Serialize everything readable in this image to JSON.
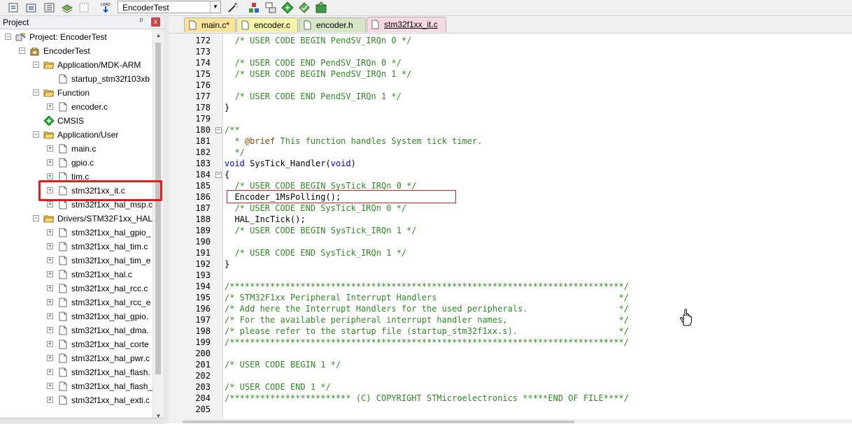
{
  "toolbar": {
    "target_name": "EncoderTest",
    "buttons": [
      "options-icon",
      "rebuild-icon",
      "batch-build-icon",
      "layers-icon",
      "download-icon",
      "load-icon",
      "magic-wand-icon",
      "manage-components-icon",
      "multiproject-icon",
      "diamond-icon",
      "select-packs-icon",
      "pack-installer-icon"
    ],
    "load_label": "LOAD"
  },
  "project_panel": {
    "title": "Project",
    "pin": "ᵖ",
    "close": "x",
    "tree": [
      {
        "label": "Project: EncoderTest",
        "level": 0,
        "icon": "project-icon",
        "expander": "−"
      },
      {
        "label": "EncoderTest",
        "level": 1,
        "icon": "target-icon",
        "expander": "−"
      },
      {
        "label": "Application/MDK-ARM",
        "level": 2,
        "icon": "folder-open-icon",
        "expander": "−"
      },
      {
        "label": "startup_stm32f103xb",
        "level": 3,
        "icon": "file-icon",
        "expander": ""
      },
      {
        "label": "Function",
        "level": 2,
        "icon": "folder-open-icon",
        "expander": "−"
      },
      {
        "label": "encoder.c",
        "level": 3,
        "icon": "file-icon",
        "expander": "+"
      },
      {
        "label": "CMSIS",
        "level": 2,
        "icon": "cmsis-icon",
        "expander": ""
      },
      {
        "label": "Application/User",
        "level": 2,
        "icon": "folder-open-icon",
        "expander": "−"
      },
      {
        "label": "main.c",
        "level": 3,
        "icon": "file-icon",
        "expander": "+"
      },
      {
        "label": "gpio.c",
        "level": 3,
        "icon": "file-icon",
        "expander": "+"
      },
      {
        "label": "tim.c",
        "level": 3,
        "icon": "file-icon",
        "expander": "+"
      },
      {
        "label": "stm32f1xx_it.c",
        "level": 3,
        "icon": "file-icon",
        "expander": "+"
      },
      {
        "label": "stm32f1xx_hal_msp.c",
        "level": 3,
        "icon": "file-icon",
        "expander": "+"
      },
      {
        "label": "Drivers/STM32F1xx_HAL",
        "level": 2,
        "icon": "folder-open-icon",
        "expander": "−"
      },
      {
        "label": "stm32f1xx_hal_gpio_",
        "level": 3,
        "icon": "file-icon",
        "expander": "+"
      },
      {
        "label": "stm32f1xx_hal_tim.c",
        "level": 3,
        "icon": "file-icon",
        "expander": "+"
      },
      {
        "label": "stm32f1xx_hal_tim_e",
        "level": 3,
        "icon": "file-icon",
        "expander": "+"
      },
      {
        "label": "stm32f1xx_hal.c",
        "level": 3,
        "icon": "file-icon",
        "expander": "+"
      },
      {
        "label": "stm32f1xx_hal_rcc.c",
        "level": 3,
        "icon": "file-icon",
        "expander": "+"
      },
      {
        "label": "stm32f1xx_hal_rcc_e",
        "level": 3,
        "icon": "file-icon",
        "expander": "+"
      },
      {
        "label": "stm32f1xx_hal_gpio.",
        "level": 3,
        "icon": "file-icon",
        "expander": "+"
      },
      {
        "label": "stm32f1xx_hal_dma.",
        "level": 3,
        "icon": "file-icon",
        "expander": "+"
      },
      {
        "label": "stm32f1xx_hal_corte",
        "level": 3,
        "icon": "file-icon",
        "expander": "+"
      },
      {
        "label": "stm32f1xx_hal_pwr.c",
        "level": 3,
        "icon": "file-icon",
        "expander": "+"
      },
      {
        "label": "stm32f1xx_hal_flash.",
        "level": 3,
        "icon": "file-icon",
        "expander": "+"
      },
      {
        "label": "stm32f1xx_hal_flash_",
        "level": 3,
        "icon": "file-icon",
        "expander": "+"
      },
      {
        "label": "stm32f1xx_hal_exti.c",
        "level": 3,
        "icon": "file-icon",
        "expander": "+"
      }
    ]
  },
  "tabs": [
    {
      "label": "main.c*",
      "color": "#fbe39a",
      "active": false
    },
    {
      "label": "encoder.c",
      "color": "#f4f3a8",
      "active": false
    },
    {
      "label": "encoder.h",
      "color": "#d6e6c4",
      "active": false
    },
    {
      "label": "stm32f1xx_it.c",
      "color": "#f7d9e0",
      "active": true
    }
  ],
  "code_lines": [
    {
      "n": "172",
      "fold": "",
      "segs": [
        {
          "t": "  /* USER CODE BEGIN PendSV_IRQn 0 */",
          "c": "c-com"
        }
      ]
    },
    {
      "n": "173",
      "fold": "",
      "segs": []
    },
    {
      "n": "174",
      "fold": "",
      "segs": [
        {
          "t": "  /* USER CODE END PendSV_IRQn 0 */",
          "c": "c-com"
        }
      ]
    },
    {
      "n": "175",
      "fold": "",
      "segs": [
        {
          "t": "  /* USER CODE BEGIN PendSV_IRQn 1 */",
          "c": "c-com"
        }
      ]
    },
    {
      "n": "176",
      "fold": "",
      "segs": []
    },
    {
      "n": "177",
      "fold": "",
      "segs": [
        {
          "t": "  /* USER CODE END PendSV_IRQn 1 */",
          "c": "c-com"
        }
      ]
    },
    {
      "n": "178",
      "fold": "",
      "segs": [
        {
          "t": "}",
          "c": ""
        }
      ]
    },
    {
      "n": "179",
      "fold": "",
      "segs": []
    },
    {
      "n": "180",
      "fold": "−",
      "segs": [
        {
          "t": "/**",
          "c": "c-com"
        }
      ]
    },
    {
      "n": "181",
      "fold": "",
      "segs": [
        {
          "t": "  * ",
          "c": "c-com"
        },
        {
          "t": "@brief",
          "c": "c-tag"
        },
        {
          "t": " This function handles System tick timer.",
          "c": "c-com"
        }
      ]
    },
    {
      "n": "182",
      "fold": "",
      "segs": [
        {
          "t": "  */",
          "c": "c-com"
        }
      ]
    },
    {
      "n": "183",
      "fold": "",
      "segs": [
        {
          "t": "void",
          "c": "c-kw"
        },
        {
          "t": " SysTick_Handler(",
          "c": ""
        },
        {
          "t": "void",
          "c": "c-kw"
        },
        {
          "t": ")",
          "c": ""
        }
      ]
    },
    {
      "n": "184",
      "fold": "−",
      "segs": [
        {
          "t": "{",
          "c": ""
        }
      ]
    },
    {
      "n": "185",
      "fold": "",
      "segs": [
        {
          "t": "  /* USER CODE BEGIN SysTick_IRQn 0 */",
          "c": "c-com"
        }
      ]
    },
    {
      "n": "186",
      "fold": "",
      "segs": [
        {
          "t": "  Encoder_1MsPolling();",
          "c": ""
        }
      ]
    },
    {
      "n": "187",
      "fold": "",
      "segs": [
        {
          "t": "  /* USER CODE END SysTick_IRQn 0 */",
          "c": "c-com"
        }
      ]
    },
    {
      "n": "188",
      "fold": "",
      "segs": [
        {
          "t": "  HAL_IncTick();",
          "c": ""
        }
      ]
    },
    {
      "n": "189",
      "fold": "",
      "segs": [
        {
          "t": "  /* USER CODE BEGIN SysTick_IRQn 1 */",
          "c": "c-com"
        }
      ]
    },
    {
      "n": "190",
      "fold": "",
      "segs": []
    },
    {
      "n": "191",
      "fold": "",
      "segs": [
        {
          "t": "  /* USER CODE END SysTick_IRQn 1 */",
          "c": "c-com"
        }
      ]
    },
    {
      "n": "192",
      "fold": "",
      "segs": [
        {
          "t": "}",
          "c": ""
        }
      ]
    },
    {
      "n": "193",
      "fold": "",
      "segs": []
    },
    {
      "n": "194",
      "fold": "",
      "segs": [
        {
          "t": "/******************************************************************************/",
          "c": "c-com"
        }
      ]
    },
    {
      "n": "195",
      "fold": "",
      "segs": [
        {
          "t": "/* STM32F1xx Peripheral Interrupt Handlers                                    */",
          "c": "c-com"
        }
      ]
    },
    {
      "n": "196",
      "fold": "",
      "segs": [
        {
          "t": "/* Add here the Interrupt Handlers for the used peripherals.                  */",
          "c": "c-com"
        }
      ]
    },
    {
      "n": "197",
      "fold": "",
      "segs": [
        {
          "t": "/* For the available peripheral interrupt handler names,                      */",
          "c": "c-com"
        }
      ]
    },
    {
      "n": "198",
      "fold": "",
      "segs": [
        {
          "t": "/* please refer to the startup file (startup_stm32f1xx.s).                    */",
          "c": "c-com"
        }
      ]
    },
    {
      "n": "199",
      "fold": "",
      "segs": [
        {
          "t": "/******************************************************************************/",
          "c": "c-com"
        }
      ]
    },
    {
      "n": "200",
      "fold": "",
      "segs": []
    },
    {
      "n": "201",
      "fold": "",
      "segs": [
        {
          "t": "/* USER CODE BEGIN 1 */",
          "c": "c-com"
        }
      ]
    },
    {
      "n": "202",
      "fold": "",
      "segs": []
    },
    {
      "n": "203",
      "fold": "",
      "segs": [
        {
          "t": "/* USER CODE END 1 */",
          "c": "c-com"
        }
      ]
    },
    {
      "n": "204",
      "fold": "",
      "segs": [
        {
          "t": "/************************ (C) COPYRIGHT STMicroelectronics *****END OF FILE****/",
          "c": "c-com"
        }
      ]
    },
    {
      "n": "205",
      "fold": "",
      "segs": []
    }
  ],
  "colors": {
    "highlight": "#e31b1b",
    "comment": "#2e8b23",
    "keyword": "#0000ff"
  }
}
